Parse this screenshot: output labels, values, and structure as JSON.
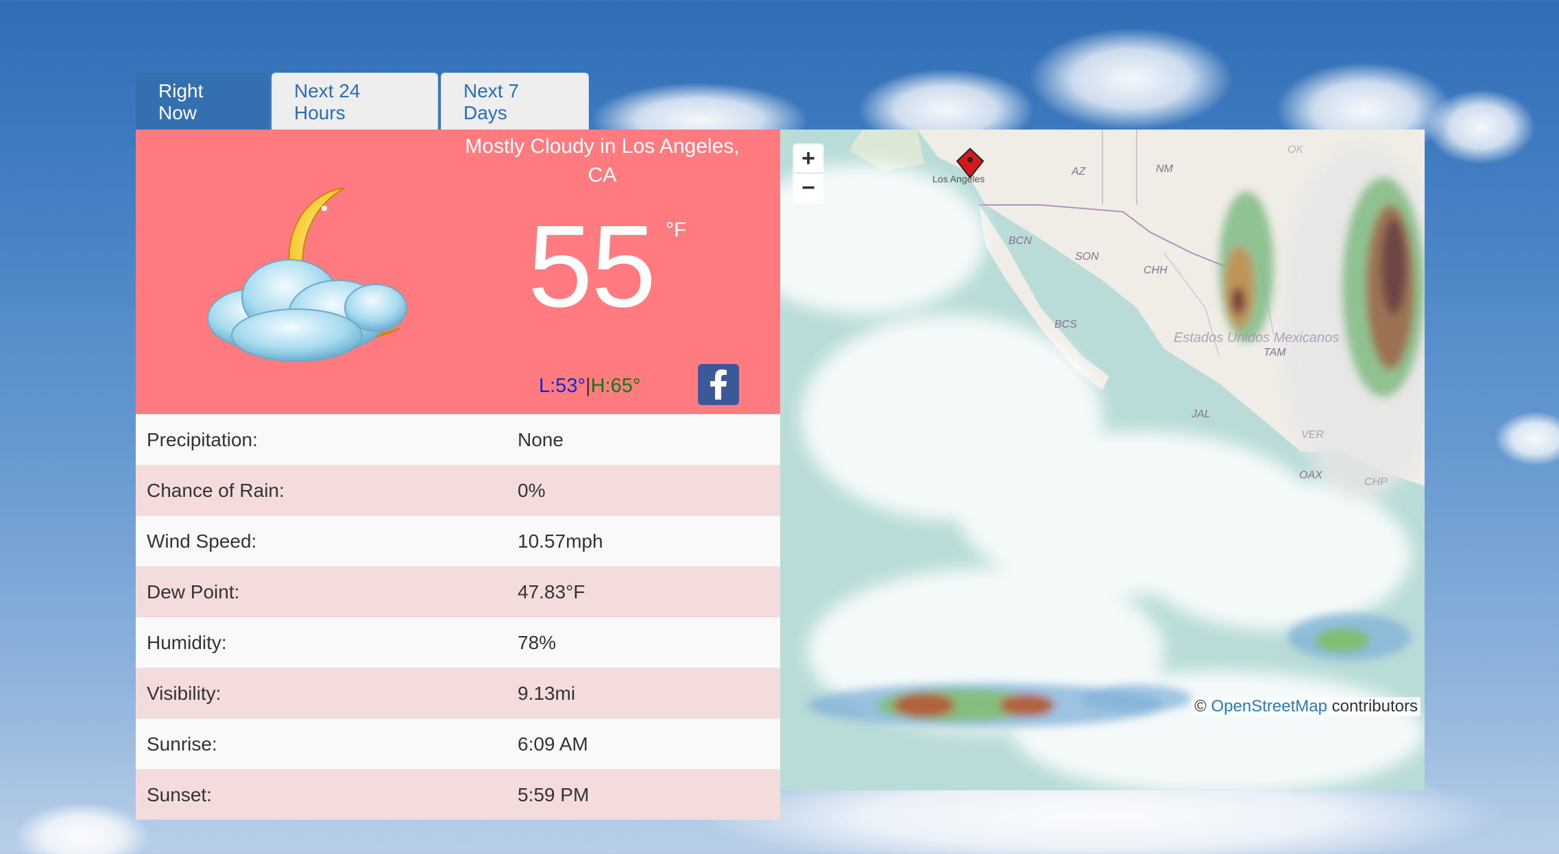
{
  "tabs": [
    {
      "label": "Right Now"
    },
    {
      "label": "Next 24 Hours"
    },
    {
      "label": "Next 7 Days"
    }
  ],
  "current": {
    "condition": "Mostly Cloudy in Los Angeles, CA",
    "temperature": "55",
    "unit": "°F",
    "low": "L:53°",
    "separator": "|",
    "high": "H:65°",
    "icon": "partly-cloudy-night-icon"
  },
  "details": [
    {
      "label": "Precipitation:",
      "value": "None"
    },
    {
      "label": "Chance of Rain:",
      "value": "0%"
    },
    {
      "label": "Wind Speed:",
      "value": "10.57mph"
    },
    {
      "label": "Dew Point:",
      "value": "47.83°F"
    },
    {
      "label": "Humidity:",
      "value": "78%"
    },
    {
      "label": "Visibility:",
      "value": "9.13mi"
    },
    {
      "label": "Sunrise:",
      "value": "6:09 AM"
    },
    {
      "label": "Sunset:",
      "value": "5:59 PM"
    }
  ],
  "map": {
    "zoom_in": "+",
    "zoom_out": "−",
    "marker_label": "Los Angeles",
    "labels": [
      "AZ",
      "NM",
      "OK",
      "BCN",
      "SON",
      "CHH",
      "BCS",
      "Estados Unidos Mexicanos",
      "TAM",
      "JAL",
      "VER",
      "OAX",
      "CHP"
    ],
    "attribution_prefix": "©",
    "attribution_link": "OpenStreetMap",
    "attribution_suffix": "contributors"
  },
  "colors": {
    "hero_bg": "#ff7b80",
    "active_tab": "#3470b0",
    "low_color": "#1424d8",
    "high_color": "#0d7a1a",
    "facebook": "#3b5998"
  }
}
